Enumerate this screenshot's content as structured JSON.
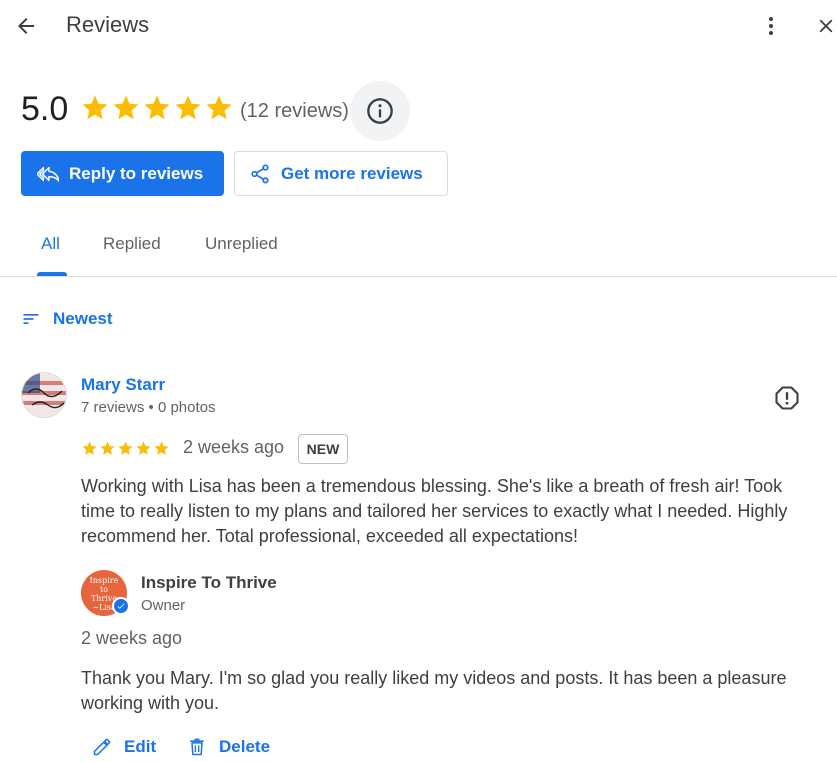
{
  "header": {
    "title": "Reviews",
    "back_icon": "arrow-left-icon",
    "more_icon": "more-vert-icon",
    "close_icon": "close-icon"
  },
  "summary": {
    "rating": "5.0",
    "star_count": 5,
    "review_count": "(12 reviews)",
    "info_icon": "info-icon"
  },
  "actions": {
    "reply_label": "Reply to reviews",
    "get_more_label": "Get more reviews"
  },
  "tabs": [
    {
      "label": "All",
      "active": true
    },
    {
      "label": "Replied",
      "active": false
    },
    {
      "label": "Unreplied",
      "active": false
    }
  ],
  "sort": {
    "label": "Newest"
  },
  "review": {
    "name": "Mary Starr",
    "meta": "7 reviews • 0 photos",
    "stars": 5,
    "time": "2 weeks ago",
    "badge": "NEW",
    "text": "Working with Lisa has been a tremendous blessing. She's like a breath of fresh air! Took time to really listen to my plans and tailored her services to exactly what I needed. Highly recommend her. Total professional, exceeded all expectations!"
  },
  "reply": {
    "owner_name": "Inspire To Thrive",
    "owner_role": "Owner",
    "time": "2 weeks ago",
    "text": "Thank you Mary. I'm so glad you really liked my videos and posts. It has been a pleasure working with you.",
    "edit_label": "Edit",
    "delete_label": "Delete"
  },
  "colors": {
    "accent": "#1a73e8",
    "star": "#fbbc04",
    "owner_avatar": "#e8643c"
  }
}
